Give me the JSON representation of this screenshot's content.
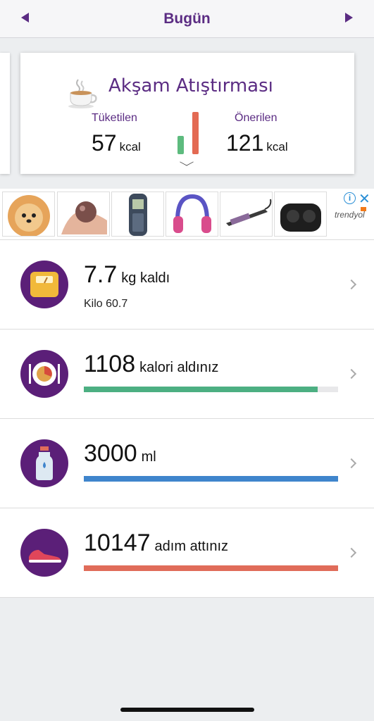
{
  "header": {
    "title": "Bugün",
    "prev_icon": "left-triangle-icon",
    "next_icon": "right-triangle-icon"
  },
  "meal_card": {
    "title": "Akşam Atıştırması",
    "icon": "tea-cup-icon",
    "consumed_label": "Tüketilen",
    "consumed_value": "57",
    "consumed_unit": "kcal",
    "recommended_label": "Önerilen",
    "recommended_value": "121",
    "recommended_unit": "kcal",
    "consumed_bar_color": "#5dbb7e",
    "recommended_bar_color": "#e36a53"
  },
  "ad": {
    "brand": "trendyol",
    "info_symbol": "i",
    "close_symbol": "✕",
    "items": [
      "pomeranian-dog-ad",
      "crystal-ball-ad",
      "nokia-phone-ad",
      "headphones-ad",
      "hair-straightener-ad",
      "earbuds-ad"
    ]
  },
  "summary": {
    "weight": {
      "value": "7.7",
      "suffix": "kg kaldı",
      "sub": "Kilo 60.7",
      "icon": "scale-icon"
    },
    "calories": {
      "value": "1108",
      "suffix": "kalori aldınız",
      "icon": "plate-icon",
      "progress": 0.92,
      "color": "#4caf82"
    },
    "water": {
      "value": "3000",
      "suffix": "ml",
      "icon": "water-bottle-icon",
      "progress": 1.0,
      "color": "#3f85cc"
    },
    "steps": {
      "value": "10147",
      "suffix": "adım attınız",
      "icon": "sneaker-icon",
      "progress": 1.0,
      "color": "#e06c5a"
    }
  }
}
